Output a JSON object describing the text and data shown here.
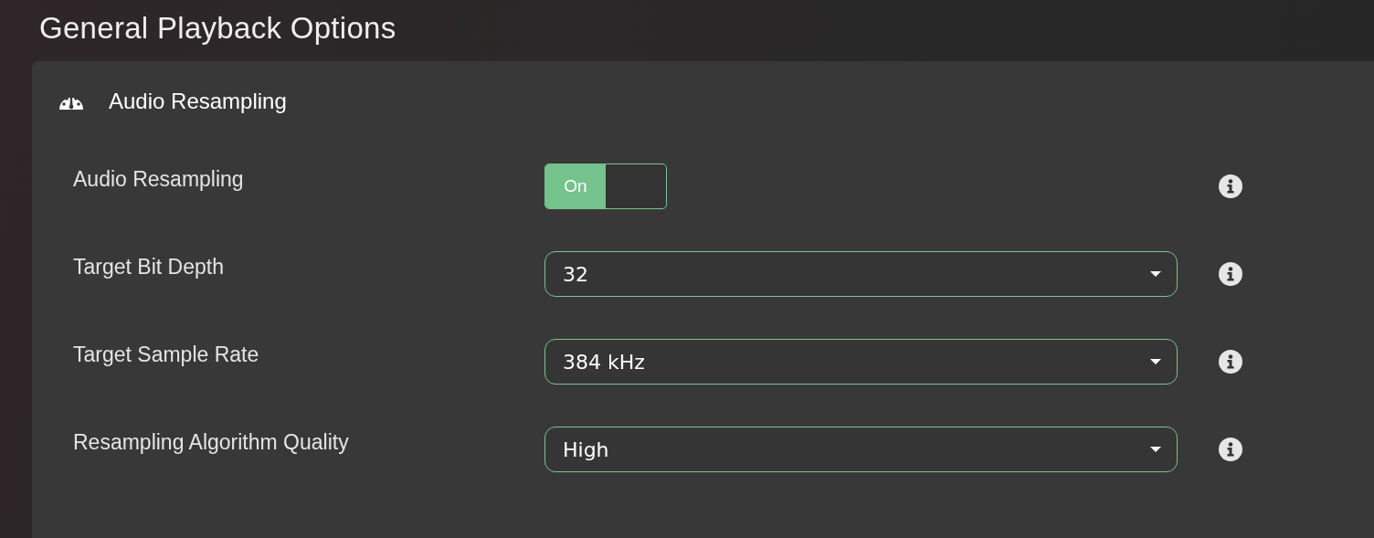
{
  "page_title": "General Playback Options",
  "section": {
    "title": "Audio Resampling",
    "settings": [
      {
        "kind": "toggle",
        "label": "Audio Resampling",
        "on": true,
        "value": "On"
      },
      {
        "kind": "select",
        "label": "Target Bit Depth",
        "value": "32"
      },
      {
        "kind": "select",
        "label": "Target Sample Rate",
        "value": "384 kHz"
      },
      {
        "kind": "select",
        "label": "Resampling Algorithm Quality",
        "value": "High"
      }
    ]
  }
}
